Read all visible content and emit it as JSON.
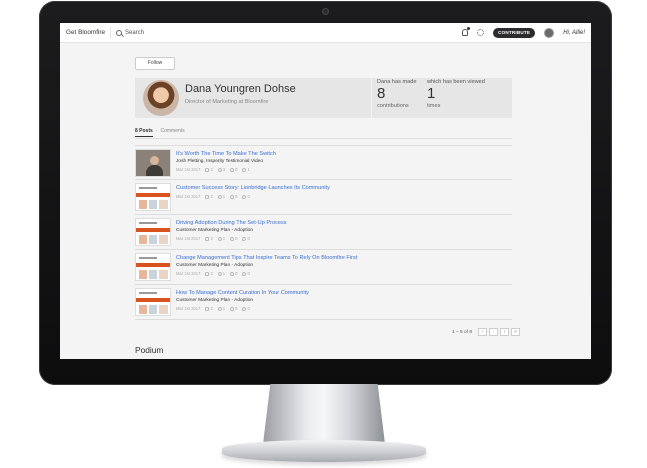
{
  "header": {
    "brand": "Get Bloomfire",
    "search_label": "Search",
    "contribute_label": "CONTRIBUTE",
    "greeting": "Hi, Allie!"
  },
  "profile": {
    "follow_label": "Follow",
    "name": "Dana Youngren Dohse",
    "title": "Director of Marketing at Bloomfire",
    "stats": {
      "made_label": "Dana has made",
      "contributions": "8",
      "contributions_label": "contributions",
      "viewed_label": "which has been viewed",
      "views": "1",
      "views_label": "times"
    }
  },
  "tabs": {
    "posts": "8 Posts",
    "separator": "·",
    "comments": "Comments"
  },
  "posts": [
    {
      "title": "It's Worth The Time To Make The Switch",
      "subtitle": "Josh Pletting, Insperity Testimonial Video",
      "date": "Mar 1st 2017",
      "stats": [
        "2",
        "3",
        "0",
        "1"
      ],
      "thumb": "video"
    },
    {
      "title": "Customer Success Story: Lionbridge Launches Its Community",
      "subtitle": "",
      "date": "Mar 1st 2017",
      "stats": [
        "2",
        "1",
        "0",
        "0"
      ],
      "thumb": "slide"
    },
    {
      "title": "Driving Adoption During The Set-Up Process",
      "subtitle": "Customer Marketing Plan - Adoption",
      "date": "Mar 1st 2017",
      "stats": [
        "2",
        "1",
        "0",
        "0"
      ],
      "thumb": "slide"
    },
    {
      "title": "Change Management Tips That Inspire Teams To Rely On Bloomfire First",
      "subtitle": "Customer Marketing Plan - Adoption",
      "date": "Mar 1st 2017",
      "stats": [
        "2",
        "1",
        "0",
        "0"
      ],
      "thumb": "slide"
    },
    {
      "title": "How To Manage Content Curation In Your Community",
      "subtitle": "Customer Marketing Plan - Adoption",
      "date": "Mar 1st 2017",
      "stats": [
        "2",
        "1",
        "0",
        "0"
      ],
      "thumb": "slide"
    }
  ],
  "pagination": {
    "text": "1 – 5 of 8",
    "first": "«",
    "prev": "‹",
    "next": "›",
    "last": "»"
  },
  "section_heading": "Podium"
}
